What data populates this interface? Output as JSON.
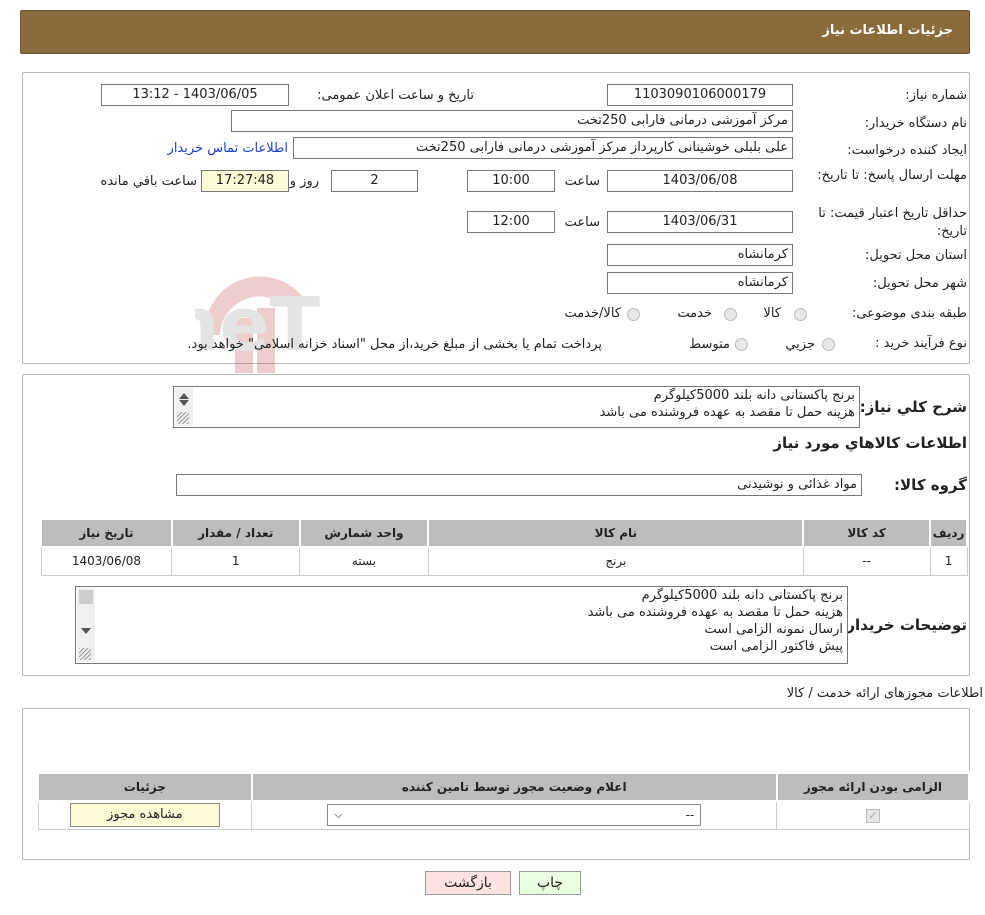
{
  "header": {
    "title": "جزئیات اطلاعات نیاز"
  },
  "need": {
    "need_number_label": "شماره نیاز:",
    "need_number": "1103090106000179",
    "announce_label": "تاریخ و ساعت اعلان عمومی:",
    "announce_value": "1403/06/05 - 13:12",
    "buyer_org_label": "نام دستگاه خریدار:",
    "buyer_org": "مرکز آموزشی  درمانی فارابی 250تخت",
    "creator_label": "ایجاد کننده درخواست:",
    "creator": "علی بلبلی خوشینانی کارپرداز مرکز آموزشی  درمانی فارابی 250تخت",
    "contact_link": "اطلاعات تماس خریدار",
    "deadline_label": "مهلت ارسال پاسخ: تا تاریخ:",
    "deadline_date": "1403/06/08",
    "time_label": "ساعت",
    "deadline_time": "10:00",
    "days_value": "2",
    "days_label": "روز و",
    "remaining_time": "17:27:48",
    "remaining_label": "ساعت باقي مانده",
    "validity_label": "حداقل تاریخ اعتبار قیمت: تا تاریخ:",
    "validity_date": "1403/06/31",
    "validity_time": "12:00",
    "province_label": "استان محل تحویل:",
    "province": "کرمانشاه",
    "city_label": "شهر محل تحویل:",
    "city": "کرمانشاه",
    "category_label": "طبقه بندی موضوعی:",
    "category_options": [
      "کالا",
      "خدمت",
      "کالا/خدمت"
    ],
    "process_label": "نوع فرآیند خرید :",
    "process_options": [
      "جزيي",
      "متوسط"
    ],
    "process_note": "پرداخت تمام یا بخشی از مبلغ خرید،از محل \"اسناد خزانه اسلامی\" خواهد بود."
  },
  "description": {
    "label": "شرح كلي نياز:",
    "lines": [
      "برنج پاکستانی دانه بلند 5000کیلوگرم",
      "هزینه حمل تا مقصد به عهده فروشنده می باشد"
    ]
  },
  "goods": {
    "section_title": "اطلاعات كالاهاي مورد نياز",
    "group_label": "گروه كالا:",
    "group_value": "مواد غذائی و نوشیدنی",
    "columns": [
      "رديف",
      "كد كالا",
      "نام كالا",
      "واحد شمارش",
      "تعداد / مقدار",
      "تاريخ نياز"
    ],
    "rows": [
      [
        "1",
        "--",
        "برنج",
        "بسته",
        "1",
        "1403/06/08"
      ]
    ]
  },
  "buyer_notes": {
    "label": "توضيحات خريدار:",
    "lines": [
      "برنج پاکستانی دانه بلند 5000کیلوگرم",
      "هزینه حمل تا مقصد به عهده فروشنده می باشد",
      "ارسال نمونه الزامی است",
      "پیش فاکتور الزامی است"
    ]
  },
  "permits": {
    "title": "اطلاعات مجوزهای ارائه خدمت / کالا",
    "columns": [
      "الزامی بودن ارائه مجوز",
      "اعلام وضعیت مجوز توسط تامین کننده",
      "جزئیات"
    ],
    "select_value": "--",
    "view_button": "مشاهده مجوز"
  },
  "actions": {
    "print": "چاپ",
    "back": "بازگشت"
  },
  "watermark": {
    "text": "AriaTender.neT"
  },
  "colors": {
    "header": "#8b6a3c",
    "link": "#1a3fd8",
    "print_btn": "#eaffdf",
    "back_btn": "#ffe3e3"
  }
}
